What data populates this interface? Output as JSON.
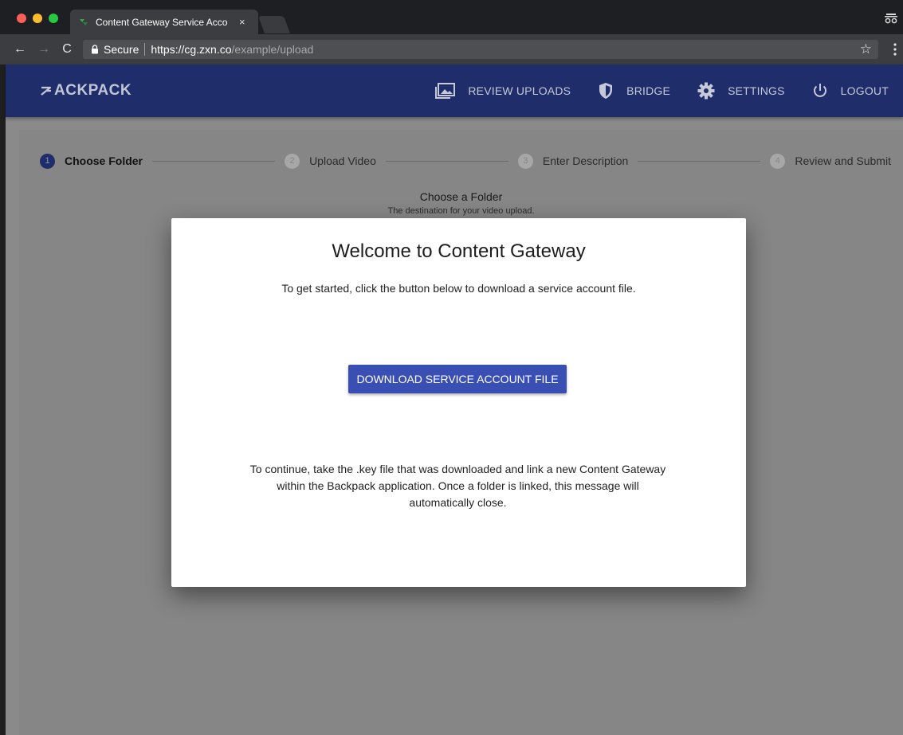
{
  "browser": {
    "tab_title": "Content Gateway Service Acco",
    "tab_close": "×",
    "secure_label": "Secure",
    "url_host": "https://cg.zxn.co",
    "url_path": "/example/upload",
    "back": "←",
    "forward": "→",
    "reload": "C",
    "star": "☆"
  },
  "appbar": {
    "logo": "ACKPACK",
    "nav": [
      {
        "label": "REVIEW UPLOADS",
        "icon": "photo-library-icon"
      },
      {
        "label": "BRIDGE",
        "icon": "shield-icon"
      },
      {
        "label": "SETTINGS",
        "icon": "gear-icon"
      },
      {
        "label": "LOGOUT",
        "icon": "power-icon"
      }
    ]
  },
  "stepper": {
    "steps": [
      {
        "num": "1",
        "label": "Choose Folder",
        "active": true
      },
      {
        "num": "2",
        "label": "Upload Video",
        "active": false
      },
      {
        "num": "3",
        "label": "Enter Description",
        "active": false
      },
      {
        "num": "4",
        "label": "Review and Submit",
        "active": false
      }
    ]
  },
  "section": {
    "title": "Choose a Folder",
    "subtitle": "The destination for your video upload."
  },
  "modal": {
    "title": "Welcome to Content Gateway",
    "intro": "To get started, click the button below to download a service account file.",
    "button": "DOWNLOAD SERVICE ACCOUNT FILE",
    "body": "To continue, take the .key file that was downloaded and link a new Content Gateway within the Backpack application. Once a folder is linked, this message will automatically close."
  },
  "colors": {
    "appbar": "#1f2d6a",
    "primary_button": "#3a4fb3",
    "active_step": "#1f2d6a"
  }
}
